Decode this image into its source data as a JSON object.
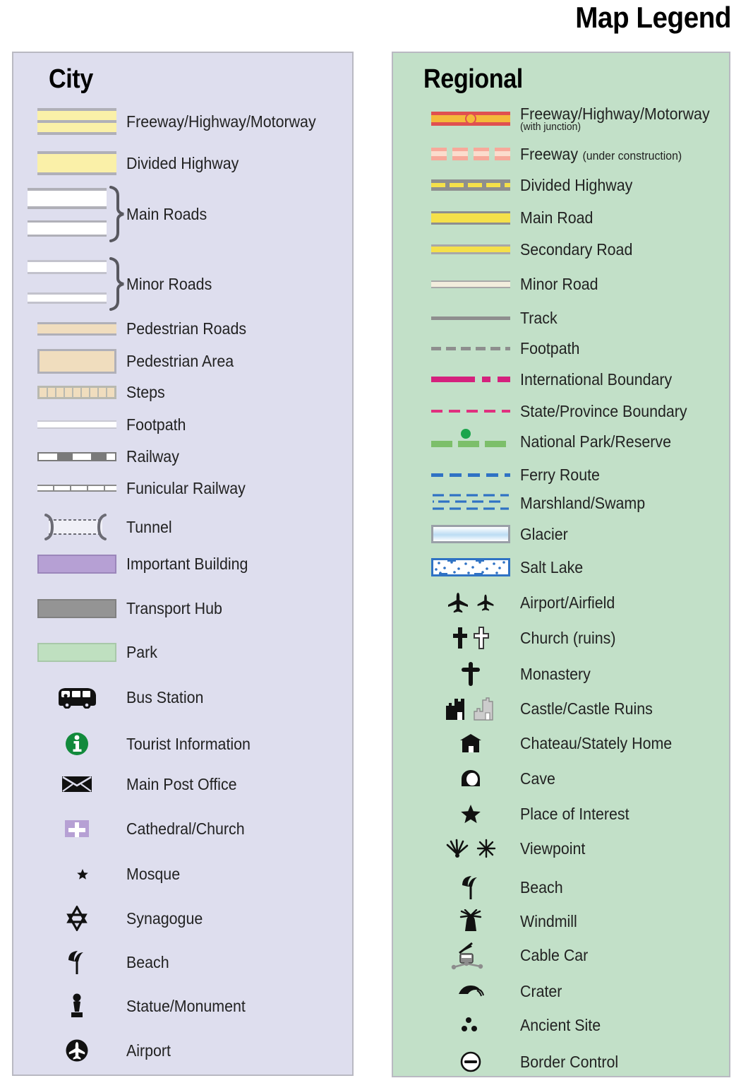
{
  "title": "Map Legend",
  "colors": {
    "city_panel_bg": "#dedeee",
    "regional_panel_bg": "#c2e0c8",
    "panel_border": "#b9b9c2",
    "highway_yellow": "#faf0a8",
    "pedestrian_tan": "#f0ddbe",
    "important_building_purple": "#b6a0d4",
    "transport_hub_grey": "#949494",
    "park_green": "#bfe0c0",
    "tourist_info_green": "#128a3c",
    "freeway_red": "#e05050",
    "freeway_orange": "#f5b93a",
    "freeway_uc_pink": "#f7a99a",
    "road_yellow": "#f5e04a",
    "road_grey": "#8e8e8e",
    "minor_road_cream": "#f2eddd",
    "international_boundary_magenta": "#d4217d",
    "state_boundary_pink": "#e0307f",
    "national_park_green": "#7cbf6a",
    "national_park_dot_green": "#1ba54c",
    "ferry_blue": "#2f72c4",
    "glacier_blue": "#bcdcf4",
    "castle_ruins_grey": "#cccccc"
  },
  "city": {
    "heading": "City",
    "items": [
      {
        "symbol": "freeway-highway-motorway-swatch",
        "label": "Freeway/Highway/Motorway"
      },
      {
        "symbol": "divided-highway-swatch",
        "label": "Divided Highway"
      },
      {
        "symbol": "main-roads-swatch",
        "label": "Main Roads"
      },
      {
        "symbol": "minor-roads-swatch",
        "label": "Minor Roads"
      },
      {
        "symbol": "pedestrian-roads-swatch",
        "label": "Pedestrian Roads"
      },
      {
        "symbol": "pedestrian-area-swatch",
        "label": "Pedestrian Area"
      },
      {
        "symbol": "steps-swatch",
        "label": "Steps"
      },
      {
        "symbol": "footpath-swatch",
        "label": "Footpath"
      },
      {
        "symbol": "railway-swatch",
        "label": "Railway"
      },
      {
        "symbol": "funicular-railway-swatch",
        "label": "Funicular Railway"
      },
      {
        "symbol": "tunnel-swatch",
        "label": "Tunnel"
      },
      {
        "symbol": "important-building-swatch",
        "label": "Important Building"
      },
      {
        "symbol": "transport-hub-swatch",
        "label": "Transport Hub"
      },
      {
        "symbol": "park-swatch",
        "label": "Park"
      },
      {
        "symbol": "bus-icon",
        "label": "Bus Station"
      },
      {
        "symbol": "tourist-information-icon",
        "label": "Tourist Information"
      },
      {
        "symbol": "envelope-icon",
        "label": "Main Post Office"
      },
      {
        "symbol": "cathedral-church-icon",
        "label": "Cathedral/Church"
      },
      {
        "symbol": "crescent-star-icon",
        "label": "Mosque"
      },
      {
        "symbol": "star-of-david-icon",
        "label": "Synagogue"
      },
      {
        "symbol": "beach-umbrella-icon",
        "label": "Beach"
      },
      {
        "symbol": "statue-monument-icon",
        "label": "Statue/Monument"
      },
      {
        "symbol": "airport-circle-icon",
        "label": "Airport"
      }
    ]
  },
  "regional": {
    "heading": "Regional",
    "items": [
      {
        "symbol": "freeway-junction-line",
        "label": "Freeway/Highway/Motorway",
        "sublabel": "(with junction)"
      },
      {
        "symbol": "freeway-under-construction-line",
        "label": "Freeway",
        "inline_note": "(under construction)"
      },
      {
        "symbol": "divided-highway-line",
        "label": "Divided Highway"
      },
      {
        "symbol": "main-road-line",
        "label": "Main Road"
      },
      {
        "symbol": "secondary-road-line",
        "label": "Secondary Road"
      },
      {
        "symbol": "minor-road-line",
        "label": "Minor Road"
      },
      {
        "symbol": "track-line",
        "label": "Track"
      },
      {
        "symbol": "footpath-dashed-line",
        "label": "Footpath"
      },
      {
        "symbol": "international-boundary-line",
        "label": "International Boundary"
      },
      {
        "symbol": "state-province-boundary-line",
        "label": "State/Province Boundary"
      },
      {
        "symbol": "national-park-line",
        "label": "National Park/Reserve"
      },
      {
        "symbol": "ferry-route-line",
        "label": "Ferry Route"
      },
      {
        "symbol": "marshland-swamp-pattern",
        "label": "Marshland/Swamp"
      },
      {
        "symbol": "glacier-swatch",
        "label": "Glacier"
      },
      {
        "symbol": "salt-lake-swatch",
        "label": "Salt Lake"
      },
      {
        "symbol": "airplane-pair-icon",
        "label": "Airport/Airfield"
      },
      {
        "symbol": "cross-pair-icon",
        "label": "Church (ruins)"
      },
      {
        "symbol": "monastery-cross-icon",
        "label": "Monastery"
      },
      {
        "symbol": "castle-pair-icon",
        "label": "Castle/Castle Ruins"
      },
      {
        "symbol": "chateau-icon",
        "label": "Chateau/Stately Home"
      },
      {
        "symbol": "cave-icon",
        "label": "Cave"
      },
      {
        "symbol": "star-icon",
        "label": "Place of Interest"
      },
      {
        "symbol": "viewpoint-pair-icon",
        "label": "Viewpoint"
      },
      {
        "symbol": "beach-umbrella-icon",
        "label": "Beach"
      },
      {
        "symbol": "windmill-icon",
        "label": "Windmill"
      },
      {
        "symbol": "cable-car-icon",
        "label": "Cable Car"
      },
      {
        "symbol": "crater-icon",
        "label": "Crater"
      },
      {
        "symbol": "ancient-site-icon",
        "label": "Ancient Site"
      },
      {
        "symbol": "border-control-icon",
        "label": "Border Control"
      }
    ]
  }
}
